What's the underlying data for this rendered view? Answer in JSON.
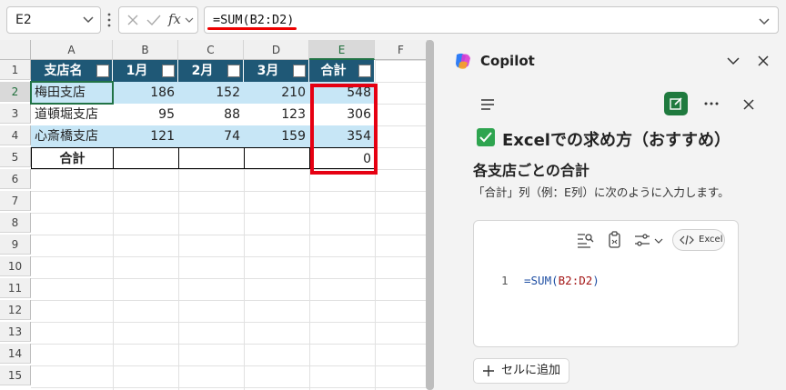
{
  "formula_bar": {
    "name_box": "E2",
    "formula": "=SUM(B2:D2)",
    "fx_label": "fx"
  },
  "sheet": {
    "columns": [
      "A",
      "B",
      "C",
      "D",
      "E",
      "F"
    ],
    "selected_column": "E",
    "rows": [
      "1",
      "2",
      "3",
      "4",
      "5",
      "6",
      "7",
      "8",
      "9",
      "10",
      "11",
      "12",
      "13",
      "14",
      "15"
    ],
    "selected_row": "2",
    "table_headers": [
      "支店名",
      "1月",
      "2月",
      "3月",
      "合計"
    ],
    "table_rows": [
      [
        "梅田支店",
        "186",
        "152",
        "210",
        "548"
      ],
      [
        "道頓堀支店",
        "95",
        "88",
        "123",
        "306"
      ],
      [
        "心斎橋支店",
        "121",
        "74",
        "159",
        "354"
      ],
      [
        "合計",
        "",
        "",
        "",
        "0"
      ]
    ],
    "header_color": "#1f5876",
    "band_color": "#c7e6f6",
    "highlight_color": "#e60012"
  },
  "copilot": {
    "title": "Copilot",
    "heading": "Excelでの求め方（おすすめ）",
    "subheading": "各支店ごとの合計",
    "description": "「合計」列（例：E列）に次のように入力します。",
    "code_line_number": "1",
    "code_fn": "=SUM(",
    "code_arg": "B2:D2",
    "code_close": ")",
    "code_lang_label": "Excel",
    "add_to_cell_label": "セルに追加"
  }
}
